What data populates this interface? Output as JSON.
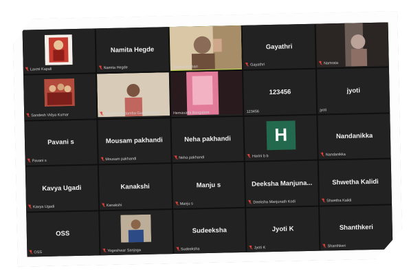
{
  "app": {
    "view": "gallery"
  },
  "tiles": [
    {
      "display": "",
      "footer": "Laxmi Kapali",
      "video": "portrait-red",
      "muted": true
    },
    {
      "display": "Namita Hegde",
      "footer": "Namita Hegde",
      "video": "",
      "muted": true
    },
    {
      "display": "",
      "footer": "Savitha Kumari",
      "video": "person-hand",
      "muted": false,
      "active": true
    },
    {
      "display": "Gayathri",
      "footer": "Gayathri",
      "video": "",
      "muted": true
    },
    {
      "display": "",
      "footer": "Namrata",
      "video": "dark-room",
      "muted": true
    },
    {
      "display": "",
      "footer": "Sandesh Vidya Kumar",
      "video": "group-red",
      "muted": true
    },
    {
      "display": "",
      "footer": "Gayathri Kadamba Gurumoorthy",
      "video": "woman-wall",
      "muted": true
    },
    {
      "display": "",
      "footer": "Hemavathi Bangalore",
      "video": "pink-room",
      "muted": false
    },
    {
      "display": "123456",
      "footer": "123456",
      "video": "",
      "muted": false
    },
    {
      "display": "jyoti",
      "footer": "jyoti",
      "video": "",
      "muted": false
    },
    {
      "display": "Pavani s",
      "footer": "Pavani s",
      "video": "",
      "muted": true
    },
    {
      "display": "Mousam pakhandi",
      "footer": "Mousam pakhandi",
      "video": "",
      "muted": true
    },
    {
      "display": "Neha pakhandi",
      "footer": "Neha pakhandi",
      "video": "",
      "muted": true
    },
    {
      "display": "",
      "footer": "Harini b b",
      "video": "",
      "avatar": "H",
      "muted": true
    },
    {
      "display": "Nandanikka",
      "footer": "Nandanikka",
      "video": "",
      "muted": true
    },
    {
      "display": "Kavya Ugadi",
      "footer": "Kavya Ugadi",
      "video": "",
      "muted": true
    },
    {
      "display": "Kanakshi",
      "footer": "Kanakshi",
      "video": "",
      "muted": true
    },
    {
      "display": "Manju s",
      "footer": "Manju s",
      "video": "",
      "muted": true
    },
    {
      "display": "Deeksha  Manjuna...",
      "footer": "Deeksha Manjunath Kodi",
      "video": "",
      "muted": true
    },
    {
      "display": "Shwetha Kalidi",
      "footer": "Shwetha Kalidi",
      "video": "",
      "muted": true
    },
    {
      "display": "OSS",
      "footer": "OSS",
      "video": "",
      "muted": true
    },
    {
      "display": "",
      "footer": "Yogeshwar Sanjoga",
      "video": "man-blue",
      "muted": true
    },
    {
      "display": "Sudeeksha",
      "footer": "Sudeeksha",
      "video": "",
      "muted": true
    },
    {
      "display": "Jyoti K",
      "footer": "Jyoti K",
      "video": "",
      "muted": true
    },
    {
      "display": "Shanthkeri",
      "footer": "Shanthkeri",
      "video": "",
      "muted": true
    }
  ],
  "colors": {
    "active_border": "#b9d34a",
    "muted_icon": "#e0413a",
    "avatar_bg": "#23694e"
  }
}
